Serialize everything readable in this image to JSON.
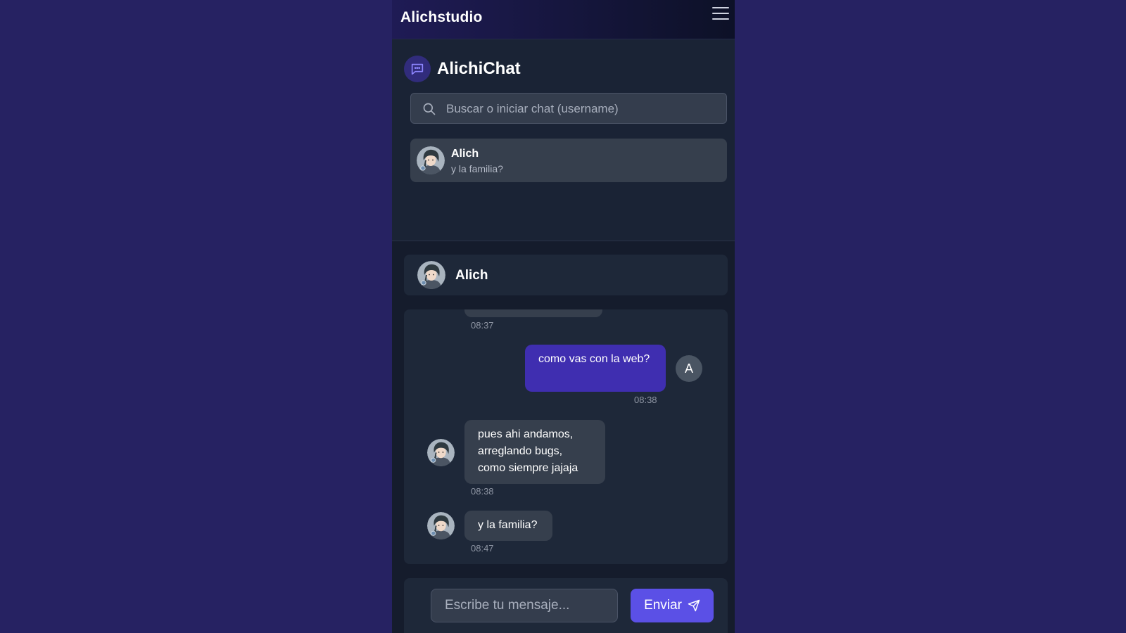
{
  "topbar": {
    "brand": "Alichstudio",
    "menu_icon": "hamburger-menu-icon"
  },
  "sidebar": {
    "title": "AlichiChat",
    "title_icon": "chat-bubble-icon",
    "search": {
      "placeholder": "Buscar o iniciar chat (username)",
      "icon": "search-icon"
    },
    "conversations": [
      {
        "name": "Alich",
        "preview": "y la familia?"
      }
    ]
  },
  "chat": {
    "contact_name": "Alich",
    "messages": [
      {
        "direction": "in",
        "text": "",
        "time": "08:37"
      },
      {
        "direction": "out",
        "text": "como vas con la web?",
        "time": "08:38",
        "sender_initial": "A"
      },
      {
        "direction": "in",
        "text": "pues ahi andamos, arreglando bugs, como siempre jajaja",
        "time": "08:38"
      },
      {
        "direction": "in",
        "text": "y la familia?",
        "time": "08:47"
      }
    ]
  },
  "composer": {
    "placeholder": "Escribe tu mensaje...",
    "send_label": "Enviar",
    "send_icon": "paper-plane-icon"
  },
  "colors": {
    "background": "#262262",
    "panel": "#1a2335",
    "bubble_in": "#363f4d",
    "bubble_out": "#3f2eb0",
    "accent": "#5b50e6"
  }
}
